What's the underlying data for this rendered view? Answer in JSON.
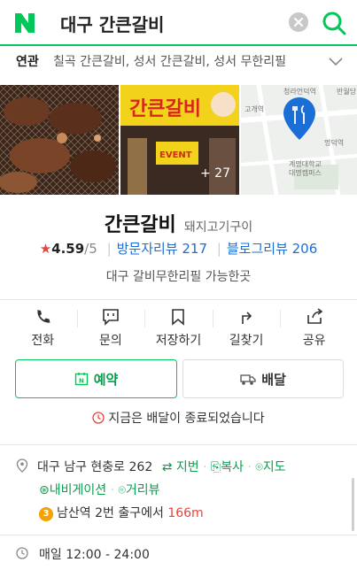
{
  "search": {
    "query": "대구 간큰갈비",
    "logo": "N"
  },
  "related": {
    "label": "연관",
    "items": "칠곡 간큰갈비, 성서 간큰갈비, 성서 무한리필"
  },
  "photos": {
    "count": "+ 27",
    "map_labels": [
      "청라언덕역",
      "반월당",
      "고개역",
      "명덕역",
      "계명대학교 대명캠퍼스"
    ]
  },
  "place": {
    "name": "간큰갈비",
    "category": "돼지고기구이",
    "rating": "4.59",
    "rating_max": "/5",
    "visitor_reviews": "방문자리뷰 217",
    "blog_reviews": "블로그리뷰 206",
    "description": "대구 갈비무한리필 가능한곳"
  },
  "actions": [
    {
      "label": "전화",
      "icon": "phone-icon"
    },
    {
      "label": "문의",
      "icon": "chat-icon"
    },
    {
      "label": "저장하기",
      "icon": "bookmark-icon"
    },
    {
      "label": "길찾기",
      "icon": "directions-icon"
    },
    {
      "label": "공유",
      "icon": "share-icon"
    }
  ],
  "buttons": {
    "reserve": "예약",
    "delivery": "배달"
  },
  "notice": "지금은 배달이 종료되었습니다",
  "address": {
    "text": "대구 남구 현충로 262",
    "jibun": "지번",
    "copy": "복사",
    "map": "지도",
    "navigation": "내비게이션",
    "street_view": "거리뷰"
  },
  "subway": {
    "line": "3",
    "station": "남산역",
    "exit": "2번 출구에서",
    "distance": "166m"
  },
  "hours": "매일 12:00 - 24:00",
  "colors": {
    "brand_green": "#03c75a",
    "link_blue": "#1b6ed6",
    "star_red": "#e8433c"
  }
}
